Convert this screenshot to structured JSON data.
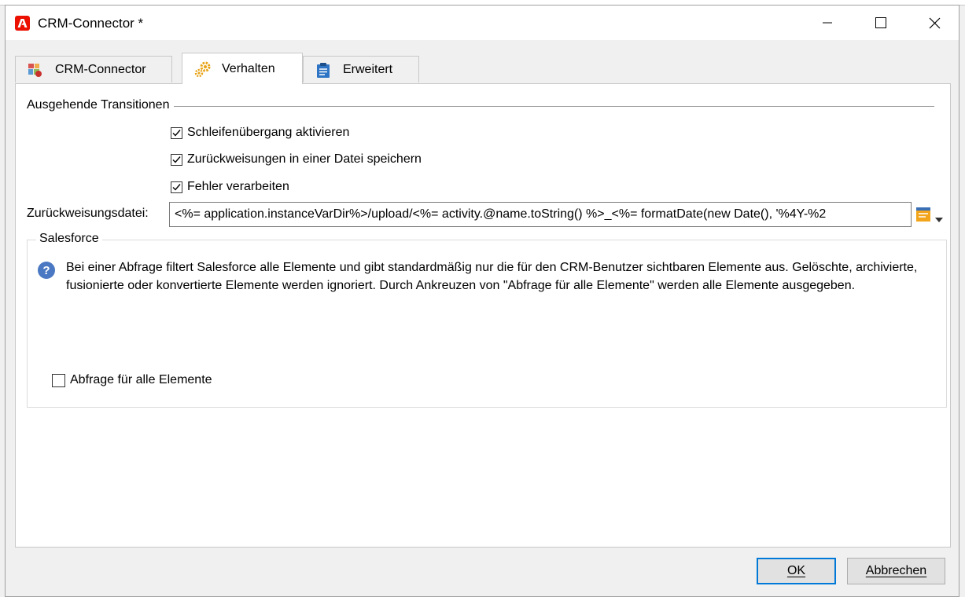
{
  "window": {
    "title": "CRM-Connector *"
  },
  "tabs": [
    {
      "label": "CRM-Connector",
      "icon": "crm-connector-icon"
    },
    {
      "label": "Verhalten",
      "icon": "gears-icon",
      "active": true
    },
    {
      "label": "Erweitert",
      "icon": "clipboard-icon"
    }
  ],
  "outgoing": {
    "group_label": "Ausgehende Transitionen",
    "checkboxes": [
      {
        "label": "Schleifenübergang aktivieren",
        "checked": true
      },
      {
        "label": "Zurückweisungen in einer Datei speichern",
        "checked": true
      },
      {
        "label": "Fehler verarbeiten",
        "checked": true
      }
    ]
  },
  "rejection_file": {
    "label": "Zurückweisungsdatei:",
    "value": "<%= application.instanceVarDir%>/upload/<%= activity.@name.toString() %>_<%= formatDate(new Date(), '%4Y-%2"
  },
  "salesforce": {
    "group_label": "Salesforce",
    "info": "Bei einer Abfrage filtert Salesforce alle Elemente und gibt standardmäßig nur die für den CRM-Benutzer sichtbaren Elemente aus. Gelöschte, archivierte, fusionierte oder konvertierte Elemente werden ignoriert. Durch Ankreuzen von \"Abfrage für alle Elemente\" werden alle Elemente ausgegeben.",
    "query_all": {
      "label": "Abfrage für alle Elemente",
      "checked": false
    }
  },
  "footer": {
    "ok": "OK",
    "cancel": "Abbrechen"
  },
  "colors": {
    "accent": "#0078d7",
    "adobe_red": "#eb1000",
    "help_blue": "#4a78c2"
  }
}
